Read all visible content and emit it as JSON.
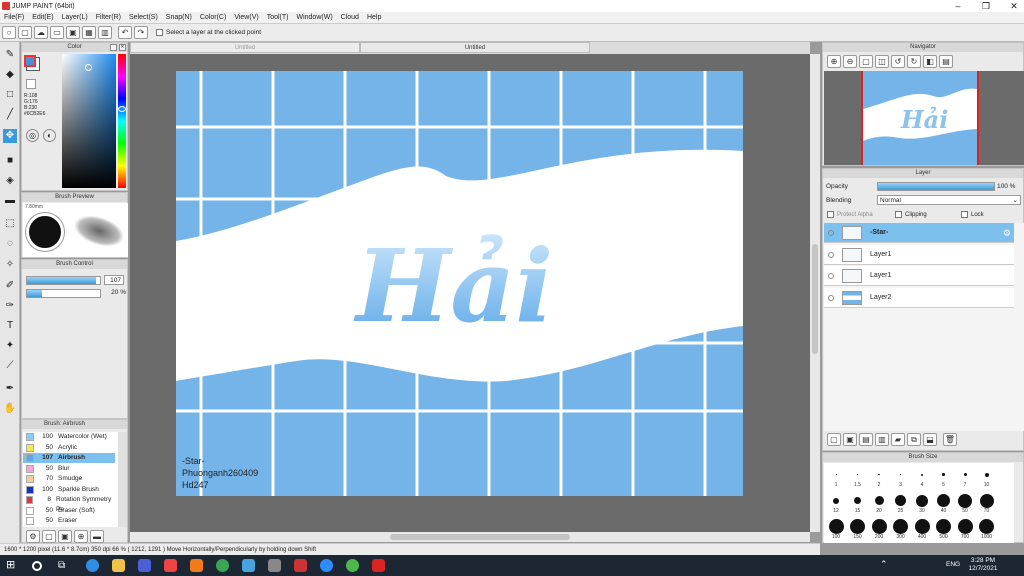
{
  "app": {
    "title": "JUMP PAINT (64bit)"
  },
  "menu": [
    "File(F)",
    "Edit(E)",
    "Layer(L)",
    "Filter(R)",
    "Select(S)",
    "Snap(N)",
    "Color(C)",
    "View(V)",
    "Tool(T)",
    "Window(W)",
    "Cloud",
    "Help"
  ],
  "toolbar": {
    "option_label": "Select a layer at the clicked point"
  },
  "tabs": [
    "Untitled",
    "Untitled"
  ],
  "color": {
    "title": "Color",
    "r": "R:108",
    "g": "G:176",
    "b": "B:230",
    "hex": "#6CB2E6",
    "foreground": "#4a90d9",
    "background": "#ffffff"
  },
  "brush_preview": {
    "title": "Brush Preview",
    "size": "7.80mm"
  },
  "brush_control": {
    "title": "Brush Control",
    "size": "107",
    "density": "20 %",
    "size_level": 0.95,
    "density_level": 0.2
  },
  "brush_list": {
    "title": "Brush: Airbrush",
    "items": [
      {
        "size": "100",
        "name": "Watercolor (Wet)",
        "color": "#7fd4f5"
      },
      {
        "size": "50",
        "name": "Acrylic",
        "color": "#f4e94d"
      },
      {
        "size": "107",
        "name": "Airbrush",
        "color": "#5aa7e8"
      },
      {
        "size": "50",
        "name": "Blur",
        "color": "#f2a7d6"
      },
      {
        "size": "70",
        "name": "Smudge",
        "color": "#f6cc9c"
      },
      {
        "size": "100",
        "name": "Sparkle Brush",
        "color": "#1533c9"
      },
      {
        "size": "8",
        "name": "Rotation Symmetry Pe",
        "color": "#d63c3c"
      },
      {
        "size": "50",
        "name": "Eraser (Soft)",
        "color": "#ffffff"
      },
      {
        "size": "50",
        "name": "Eraser",
        "color": "#ffffff"
      }
    ]
  },
  "artwork": {
    "title_text": "Hải",
    "sig": [
      "-Star-",
      "Phuonganh260409",
      "Hd247"
    ],
    "sky": "#74b4e9"
  },
  "navigator": {
    "title": "Navigator"
  },
  "layer_panel": {
    "title": "Layer",
    "opacity_label": "Opacity",
    "opacity_value": "100 %",
    "opacity_level": 1.0,
    "blending_label": "Blending",
    "blending_value": "Normal",
    "protect_alpha": "Protect Alpha",
    "clipping": "Clipping",
    "lock": "Lock",
    "layers": [
      "-Star-",
      "Layer1",
      "Layer1",
      "Layer2"
    ]
  },
  "brush_size": {
    "title": "Brush Size",
    "sizes": [
      "1",
      "1.5",
      "2",
      "3",
      "4",
      "5",
      "7",
      "10",
      "12",
      "15",
      "20",
      "25",
      "30",
      "40",
      "50",
      "70",
      "100",
      "150",
      "200",
      "300",
      "400",
      "500",
      "700",
      "1000"
    ]
  },
  "status": {
    "text": "1600 * 1200 pixel  (11.6 * 8.7cm)  350 dpi  66 %  ( 1212, 1291 )  Move Horizontally/Perpendicularly by holding down Shift"
  },
  "taskbar": {
    "time": "3:28 PM",
    "date": "12/7/2021",
    "lang": "ENG"
  }
}
